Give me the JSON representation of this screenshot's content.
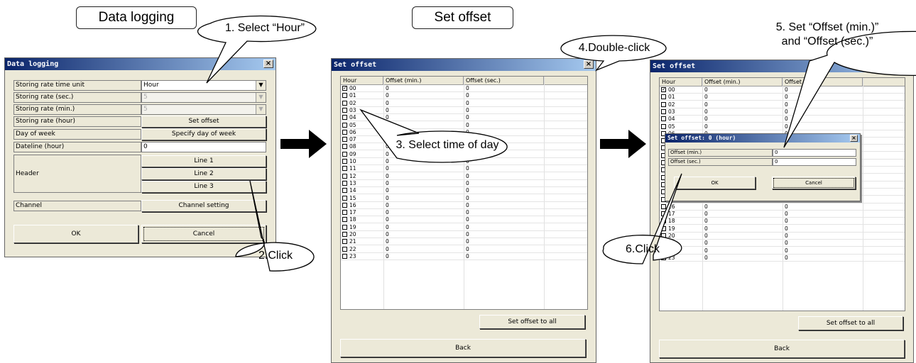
{
  "section_labels": {
    "data_logging": "Data logging",
    "set_offset": "Set offset"
  },
  "callouts": {
    "c1": "1. Select “Hour”",
    "c2": "2.Click",
    "c3": "3. Select time of day",
    "c4": "4.Double-click",
    "c5a": "5. Set “Offset (min.)”",
    "c5b": "and  “Offset (sec.)”",
    "c6": "6.Click"
  },
  "data_logging_window": {
    "title": "Data logging",
    "rows": [
      {
        "label": "Storing rate time unit",
        "value": "Hour"
      },
      {
        "label": "Storing rate (sec.)",
        "value": "5"
      },
      {
        "label": "Storing rate (min.)",
        "value": "5"
      },
      {
        "label": "Storing rate (hour)",
        "button": "Set offset"
      },
      {
        "label": "Day of week",
        "button": "Specify day of week"
      },
      {
        "label": "Dateline (hour)",
        "value": "0"
      }
    ],
    "header_label": "Header",
    "header_lines": [
      "Line 1",
      "Line 2",
      "Line 3"
    ],
    "channel_label": "Channel",
    "channel_button": "Channel setting",
    "ok": "OK",
    "cancel": "Cancel"
  },
  "set_offset_window": {
    "title": "Set offset",
    "columns": [
      "Hour",
      "Offset (min.)",
      "Offset (sec.)"
    ],
    "hours": [
      "00",
      "01",
      "02",
      "03",
      "04",
      "05",
      "06",
      "07",
      "08",
      "09",
      "10",
      "11",
      "12",
      "13",
      "14",
      "15",
      "16",
      "17",
      "18",
      "19",
      "20",
      "21",
      "22",
      "23"
    ],
    "offset_value": "0",
    "checked_hour_index": 0,
    "set_all_button": "Set offset to all",
    "back_button": "Back"
  },
  "set_offset_window2": {
    "title": "Set offset",
    "columns": [
      "Hour",
      "Offset (min.)",
      "Offset (sec.)"
    ]
  },
  "offset_dialog": {
    "title": "Set offset: 0 (hour)",
    "min_label": "Offset (min.)",
    "sec_label": "Offset (sec.)",
    "min_value": "0",
    "sec_value": "0",
    "ok": "OK",
    "cancel": "Cancel"
  }
}
